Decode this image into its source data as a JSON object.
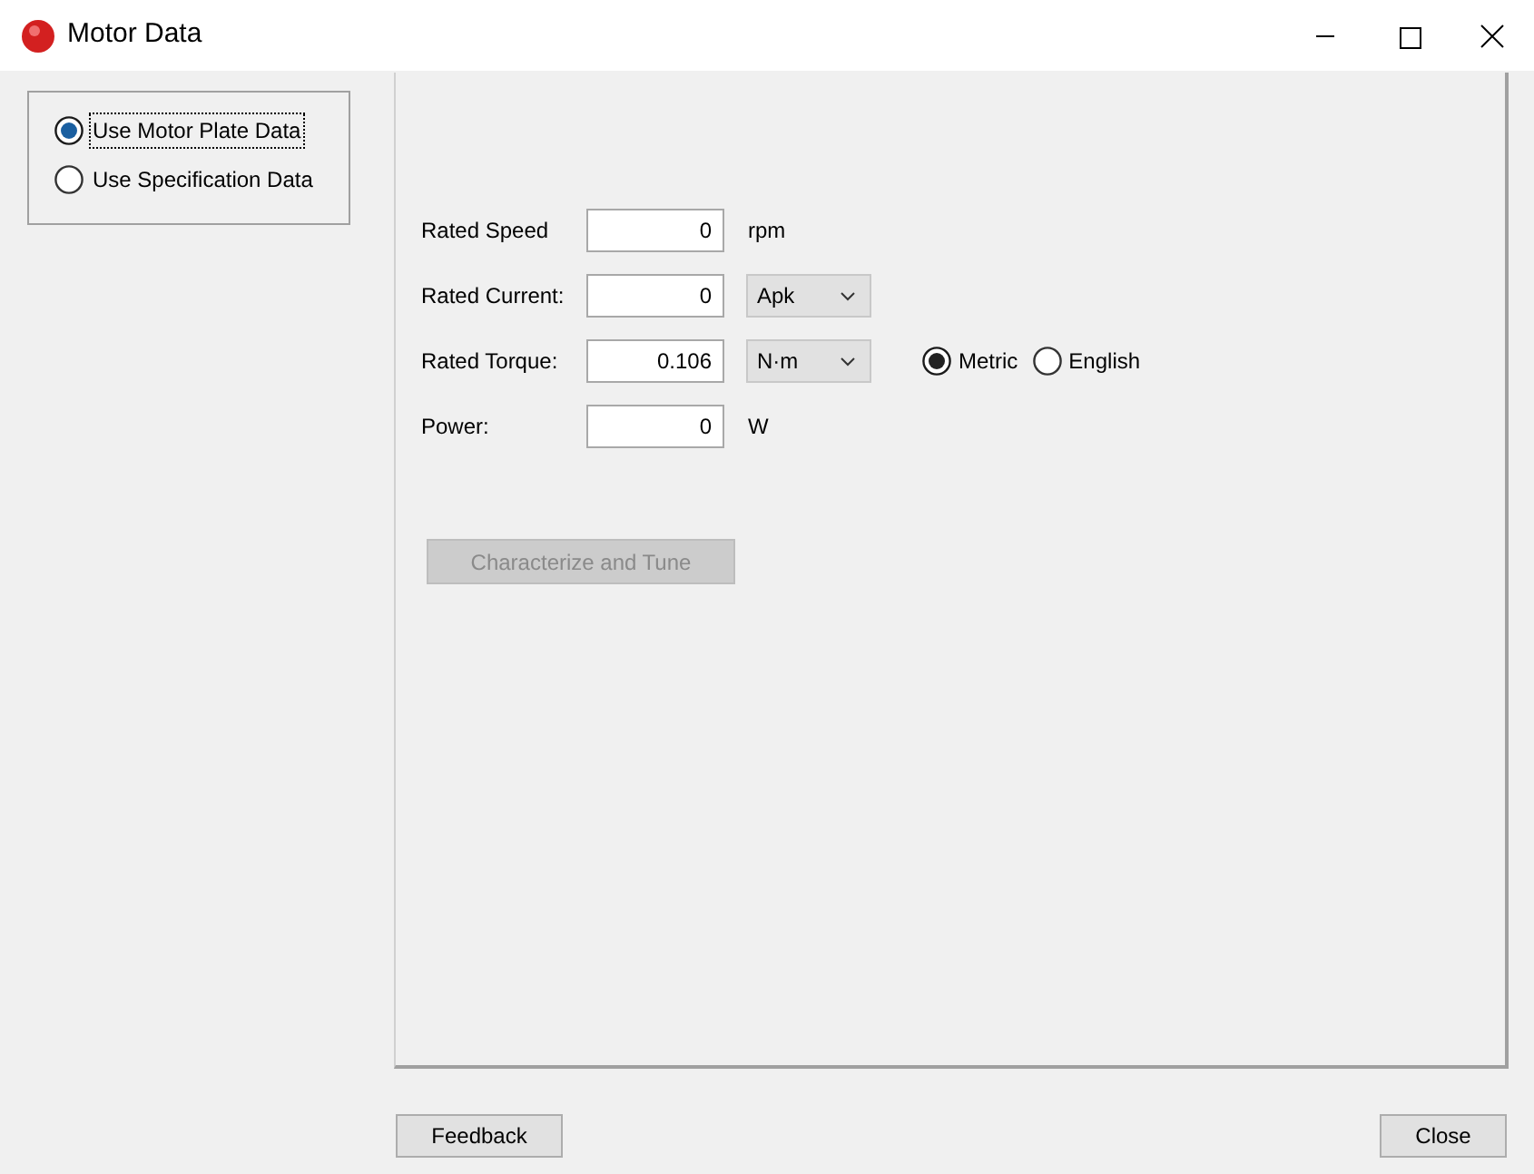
{
  "window": {
    "title": "Motor Data"
  },
  "data_source": [
    {
      "label": "Use Motor Plate Data",
      "selected": true,
      "focused": true
    },
    {
      "label": "Use Specification Data",
      "selected": false,
      "focused": false
    }
  ],
  "fields": [
    {
      "label": "Rated Speed",
      "value": "0",
      "unit": "rpm",
      "kind": "text"
    },
    {
      "label": "Rated Current:",
      "value": "0",
      "unit": "Apk",
      "kind": "dropdown"
    },
    {
      "label": "Rated Torque:",
      "value": "0.106",
      "unit": "N·m",
      "kind": "dropdown"
    },
    {
      "label": "Power:",
      "value": "0",
      "unit": "W",
      "kind": "text"
    }
  ],
  "unit_system": [
    {
      "label": "Metric",
      "selected": true
    },
    {
      "label": "English",
      "selected": false
    }
  ],
  "characterize_button": {
    "label": "Characterize and Tune",
    "disabled": true
  },
  "footer_buttons": [
    {
      "label": "Feedback"
    },
    {
      "label": "Close"
    }
  ]
}
